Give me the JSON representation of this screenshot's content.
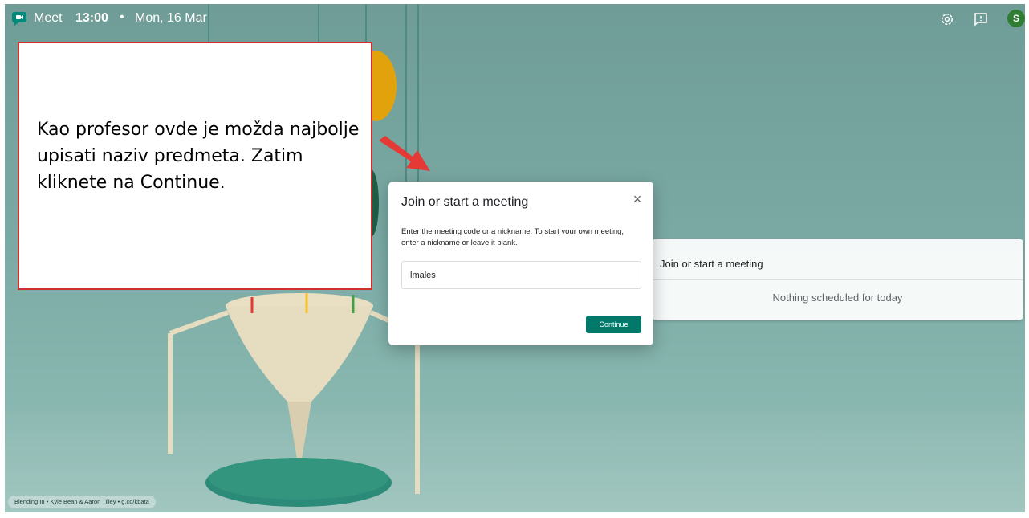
{
  "topbar": {
    "app_name": "Meet",
    "time": "13:00",
    "separator": "•",
    "date": "Mon, 16 Mar",
    "avatar_letter": "S",
    "settings_icon": "gear-icon",
    "feedback_icon": "feedback-icon"
  },
  "dialog": {
    "title": "Join or start a meeting",
    "close_glyph": "×",
    "description": "Enter the meeting code or a nickname. To start your own meeting, enter a nickname or leave it blank.",
    "input_value": "lmales",
    "continue_label": "Continue"
  },
  "side_panel": {
    "join_label": "Join or start a meeting",
    "empty_label": "Nothing scheduled for today"
  },
  "callout": {
    "text": "Kao profesor ovde je možda najbolje upisati naziv predmeta. Zatim kliknete na Continue."
  },
  "credit": "Blending In • Kyle Bean & Aaron Tilley • g.co/kbata",
  "colors": {
    "accent": "#00796b",
    "avatar": "#2e7d32",
    "callout_border": "#d32f2f",
    "arrow": "#e53935"
  }
}
